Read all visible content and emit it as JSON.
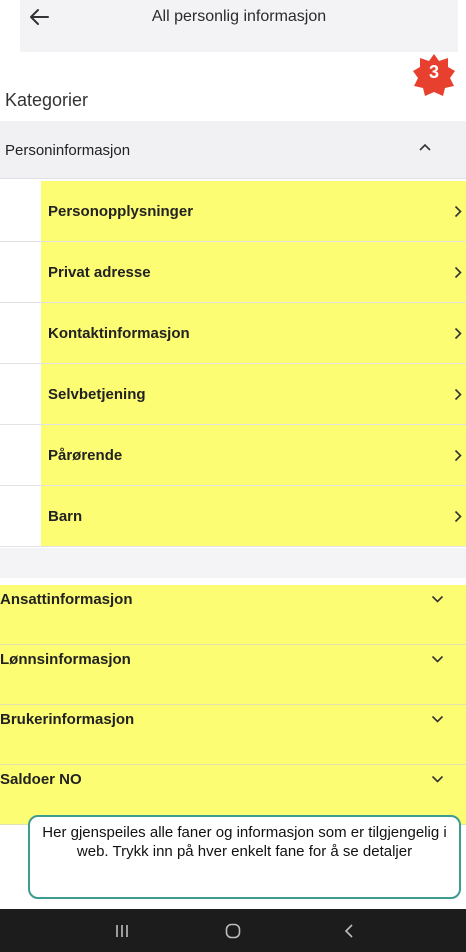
{
  "header": {
    "title": "All personlig informasjon"
  },
  "badge": {
    "number": "3"
  },
  "section": {
    "title": "Kategorier"
  },
  "group": {
    "label": "Personinformasjon"
  },
  "sub_items": [
    {
      "label": "Personopplysninger"
    },
    {
      "label": "Privat adresse"
    },
    {
      "label": "Kontaktinformasjon"
    },
    {
      "label": "Selvbetjening"
    },
    {
      "label": "Pårørende"
    },
    {
      "label": "Barn"
    }
  ],
  "categories": [
    {
      "label": "Ansattinformasjon"
    },
    {
      "label": "Lønnsinformasjon"
    },
    {
      "label": "Brukerinformasjon"
    },
    {
      "label": "Saldoer NO"
    }
  ],
  "callout": {
    "text": "Her gjenspeiles alle faner og informasjon som er tilgjengelig i web. Trykk inn på hver enkelt fane for å se detaljer"
  },
  "colors": {
    "highlight": "#fdfd73",
    "badge": "#e8402f",
    "callout_border": "#3d9b90"
  }
}
